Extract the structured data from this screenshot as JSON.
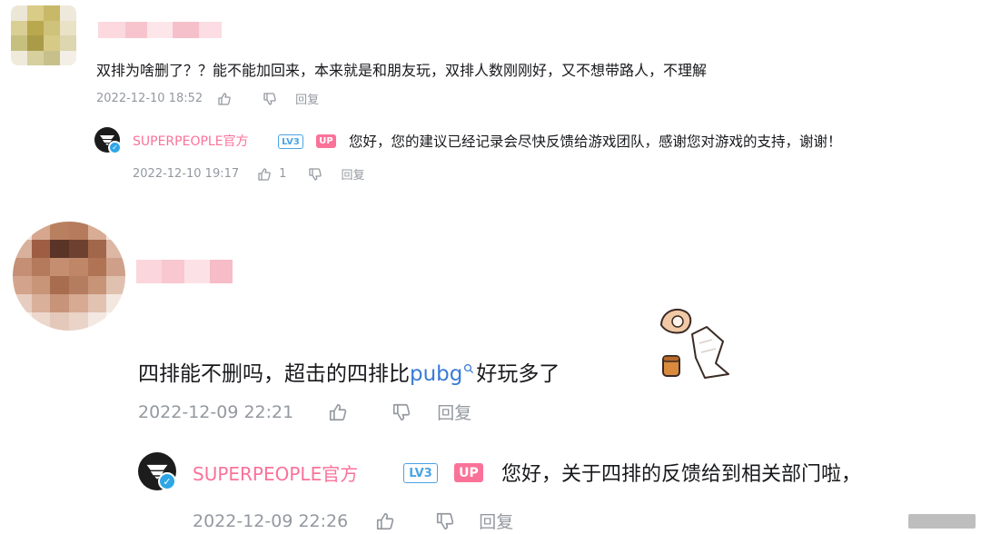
{
  "comments": [
    {
      "text": "双排为啥删了？？能不能加回来，本来就是和朋友玩，双排人数刚刚好，又不想带路人，不理解",
      "time": "2022-12-10 18:52",
      "reply_label": "回复",
      "reply": {
        "username": "SUPERPEOPLE官方",
        "level": "LV3",
        "up_badge": "UP",
        "text": "您好，您的建议已经记录会尽快反馈给游戏团队，感谢您对游戏的支持，谢谢！",
        "time": "2022-12-10 19:17",
        "likes": "1",
        "reply_label": "回复"
      }
    },
    {
      "text_before": "四排能不删吗，超击的四排比",
      "link_text": "pubg",
      "text_after": "好玩多了",
      "time": "2022-12-09 22:21",
      "reply_label": "回复",
      "reply": {
        "username": "SUPERPEOPLE官方",
        "level": "LV3",
        "up_badge": "UP",
        "text": "您好，关于四排的反馈给到相关部门啦，",
        "time": "2022-12-09 22:26",
        "reply_label": "回复"
      }
    }
  ],
  "icons": [
    "like-icon",
    "dislike-icon",
    "search-icon",
    "verified-icon",
    "sticker-icon"
  ],
  "colors": {
    "username": "#fb7299",
    "link": "#3a7bd5",
    "meta": "#9499a0",
    "level": "#4aa3e6"
  }
}
